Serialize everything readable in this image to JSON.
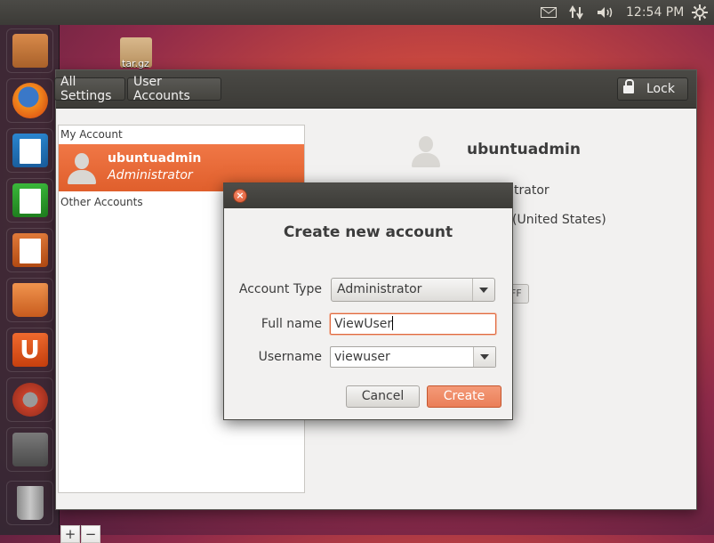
{
  "panel": {
    "clock": "12:54 PM",
    "indicators": [
      "mail-icon",
      "network-icon",
      "volume-icon",
      "gear-icon"
    ]
  },
  "launcher": {
    "items": [
      {
        "name": "files",
        "color": "#c77b3a"
      },
      {
        "name": "firefox",
        "color": "#e66000"
      },
      {
        "name": "writer",
        "color": "#1f6fb5"
      },
      {
        "name": "calc",
        "color": "#2e9a2e"
      },
      {
        "name": "impress",
        "color": "#c85a1a"
      },
      {
        "name": "software-center",
        "color": "#e0762e"
      },
      {
        "name": "ubuntu-one",
        "color": "#dd4814"
      },
      {
        "name": "system-settings",
        "color": "#c7402a"
      },
      {
        "name": "workspaces",
        "color": "#666666"
      },
      {
        "name": "trash",
        "color": "#8a8a8a"
      }
    ]
  },
  "desktop": {
    "file_label": "tar.gz"
  },
  "toolbar": {
    "all_settings": "All Settings",
    "user_accounts": "User Accounts",
    "lock": "Lock"
  },
  "userlist": {
    "my_account_header": "My Account",
    "selected_user": {
      "name": "ubuntuadmin",
      "role": "Administrator"
    },
    "other_accounts_header": "Other Accounts",
    "add_label": "+",
    "remove_label": "−"
  },
  "details": {
    "name": "ubuntuadmin",
    "account_type_partial": "trator",
    "language_partial": "(United States)",
    "toggle_partial": "FF"
  },
  "dialog": {
    "title": "Create new account",
    "account_type_label": "Account Type",
    "account_type_value": "Administrator",
    "full_name_label": "Full name",
    "full_name_value": "ViewUser",
    "username_label": "Username",
    "username_value": "viewuser",
    "cancel": "Cancel",
    "create": "Create",
    "close_glyph": "×"
  },
  "colors": {
    "accent": "#e05f2c",
    "create_button": "#ea7e58"
  }
}
